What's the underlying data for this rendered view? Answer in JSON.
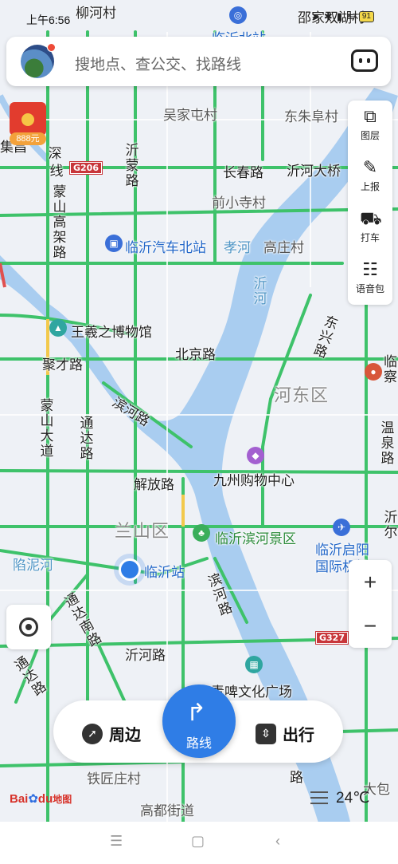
{
  "status_bar": {
    "time": "上午6:56",
    "battery": "91"
  },
  "search": {
    "placeholder": "搜地点、查公交、找路线"
  },
  "red_packet": {
    "amount": "888元"
  },
  "side_panel": {
    "items": [
      {
        "label": "图层",
        "icon": "layers-icon"
      },
      {
        "label": "上报",
        "icon": "edit-icon"
      },
      {
        "label": "打车",
        "icon": "taxi-icon"
      },
      {
        "label": "语音包",
        "icon": "voice-pack-icon"
      }
    ]
  },
  "zoom": {
    "in": "+",
    "out": "−"
  },
  "map_labels": {
    "liuhecun": "柳河村",
    "shaojia": "邵家双湖村",
    "linyi_north": "临沂北站",
    "wujiatun": "吴家屯村",
    "dongzhu": "东朱阜村",
    "jiqi": "集昌",
    "shen": "深",
    "xian": "线",
    "g206": "G206",
    "yimeng": "沂蒙路",
    "changchun": "长春路",
    "yihe_bridge": "沂河大桥",
    "qianxiaosi": "前小寺村",
    "mengshan_elevated": "蒙山高架路",
    "bus_north": "临沂汽车北站",
    "xiaohe": "孝河",
    "gaozhuang": "高庄村",
    "yihe_water": "沂河",
    "wangxizhi": "王羲之博物馆",
    "dongxing": "东兴路",
    "beijing": "北京路",
    "jucai": "聚才路",
    "hedong": "河东区",
    "mengshan_ave": "蒙山大道",
    "tongda": "通达路",
    "binhe": "滨河路",
    "jiuzhou": "九州购物中心",
    "jiefang": "解放路",
    "lanshan": "兰山区",
    "scenic": "临沂滨河景区",
    "airport": "临沂启阳国际机场",
    "wenquan": "温泉路",
    "yini": "沂尔",
    "xianni": "陷泥河",
    "station": "临沂站",
    "tongda_s": "通达南路",
    "binhe_s": "滨河路",
    "g327": "G327",
    "tongda2": "通达路",
    "yihe_road": "沂河路",
    "qingpi": "青啤文化广场",
    "tiejiang": "铁匠庄村",
    "gaodu": "高都街道",
    "dabao": "大包",
    "linji": "临察",
    "lu_end": "路"
  },
  "bottom_bar": {
    "nearby": "周边",
    "route": "路线",
    "travel": "出行"
  },
  "brand": {
    "logo_text": "Bai",
    "logo_text2": "du",
    "logo_map": "地图"
  },
  "weather": {
    "temperature": "24℃"
  }
}
